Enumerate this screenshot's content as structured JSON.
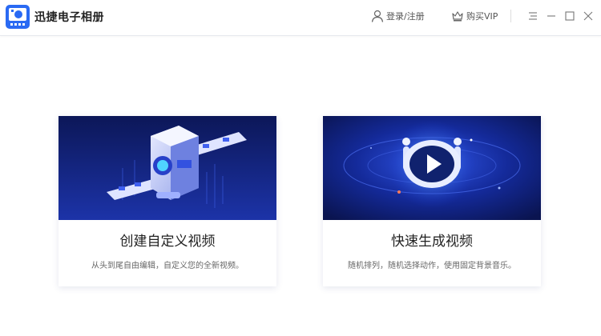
{
  "app": {
    "title": "迅捷电子相册"
  },
  "header": {
    "login_label": "登录/注册",
    "vip_label": "购买VIP"
  },
  "colors": {
    "accent": "#2a6af3",
    "banner_dark": "#0d1a5e",
    "banner_light": "#2c48c8"
  },
  "cards": [
    {
      "title": "创建自定义视频",
      "description": "从头到尾自由编辑，自定义您的全新视频。",
      "icon": "video-machine-illustration"
    },
    {
      "title": "快速生成视频",
      "description": "随机排列，随机选择动作，使用固定背景音乐。",
      "icon": "play-button-illustration"
    }
  ]
}
